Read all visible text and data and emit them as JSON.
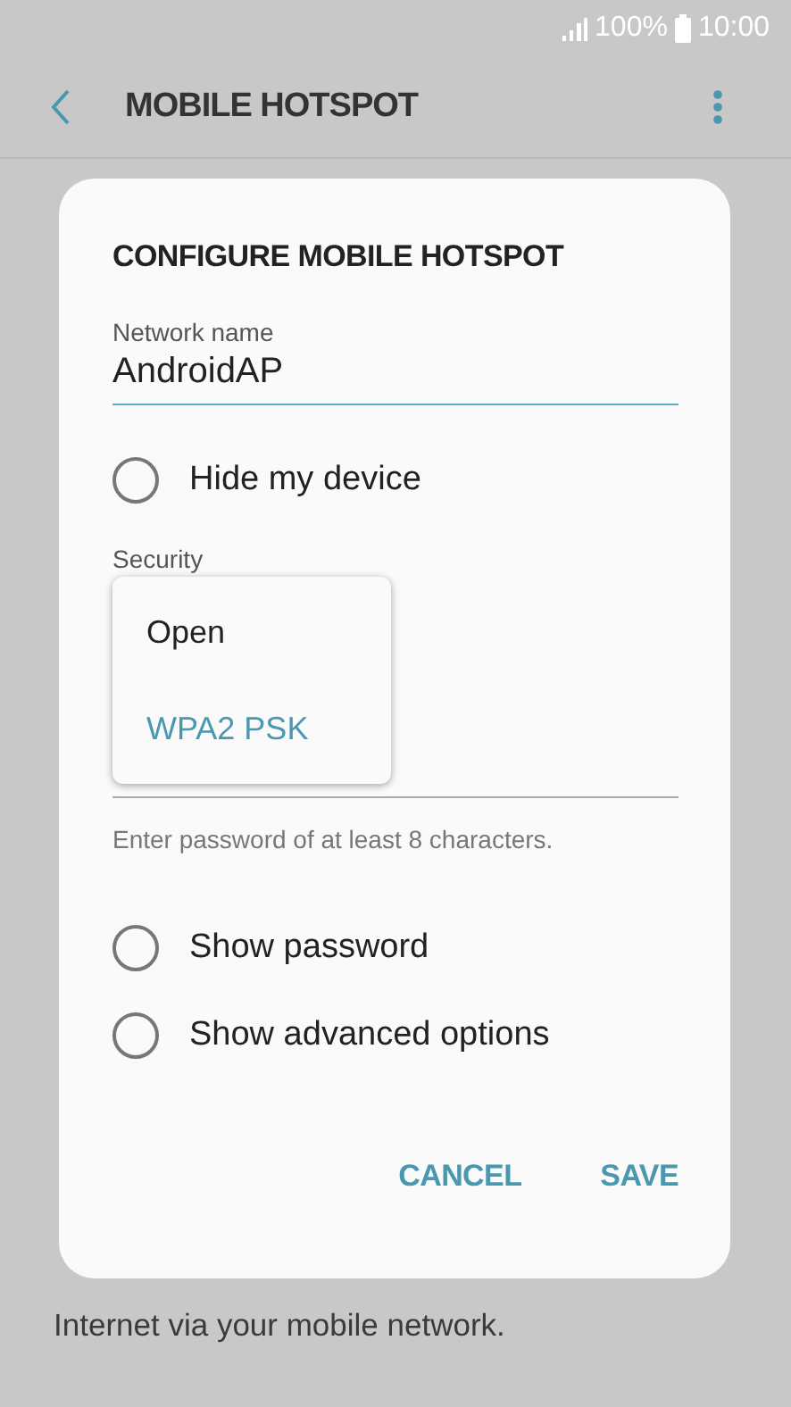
{
  "status_bar": {
    "battery": "100%",
    "time": "10:00"
  },
  "app_bar": {
    "title": "MOBILE HOTSPOT"
  },
  "background_text": [
    "Internet via your mobile network."
  ],
  "dialog": {
    "title": "CONFIGURE MOBILE HOTSPOT",
    "network_name": {
      "label": "Network name",
      "value": "AndroidAP",
      "focused": true
    },
    "hide_device": {
      "label": "Hide my device",
      "checked": false
    },
    "security": {
      "label": "Security",
      "options": [
        {
          "label": "Open",
          "selected": false
        },
        {
          "label": "WPA2 PSK",
          "selected": true
        }
      ]
    },
    "password": {
      "hint": "Enter password of at least 8 characters."
    },
    "options": [
      {
        "label": "Show password",
        "checked": false
      },
      {
        "label": "Show advanced options",
        "checked": false
      }
    ],
    "buttons": [
      "CANCEL",
      "SAVE"
    ]
  }
}
